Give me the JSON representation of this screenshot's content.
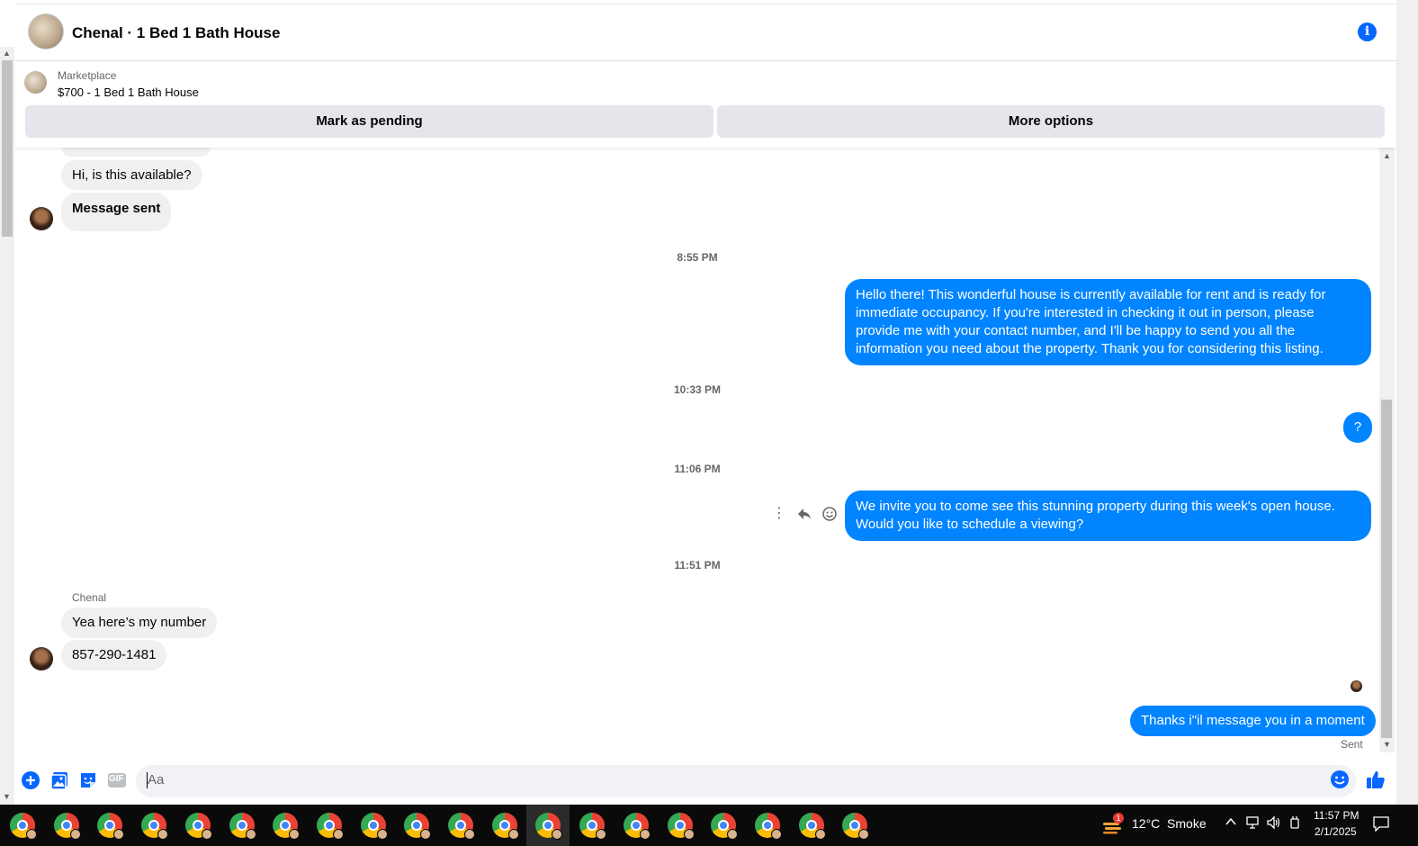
{
  "header": {
    "title": "Chenal · 1 Bed 1 Bath House",
    "info_icon": "i"
  },
  "listing": {
    "kicker": "Marketplace",
    "product": "$700 - 1 Bed 1 Bath House",
    "mark_pending_label": "Mark as pending",
    "more_options_label": "More options"
  },
  "messages": {
    "m1": "Hi, is this available?",
    "m2": "Message sent",
    "ts1": "8:55 PM",
    "m3": "Hello there! This wonderful house is currently available for rent and is ready for immediate occupancy. If you're interested in checking it out in person, please provide me with your contact number, and I'll be happy to send you all the information you need about the property. Thank you for considering this listing.",
    "ts2": "10:33 PM",
    "m4": "?",
    "ts3": "11:06 PM",
    "m5": "We invite you to come see this stunning property during this week's open house. Would you like to schedule a viewing?",
    "ts4": "11:51 PM",
    "sender": "Chenal",
    "m6": "Yea here’s my number",
    "m7": "857-290-1481",
    "m8": "Thanks i\"il message you in a moment",
    "status": "Sent"
  },
  "composer": {
    "placeholder": "Aa",
    "gif_label": "GIF"
  },
  "taskbar": {
    "weather": "12°C  Smoke",
    "weather_badge": "1",
    "time": "11:57 PM",
    "date": "2/1/2025",
    "app_count": 20
  },
  "colors": {
    "accent": "#0866ff",
    "bubble_out": "#0084ff",
    "bubble_in": "#f0f0f0"
  }
}
